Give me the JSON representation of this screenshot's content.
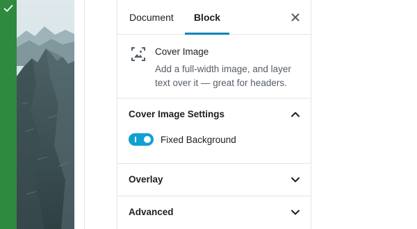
{
  "tabs": {
    "document_label": "Document",
    "block_label": "Block",
    "active": "Block"
  },
  "icons": {
    "close": "close-icon",
    "block": "cover-image-icon",
    "check": "checkmark-icon",
    "chevron_up": "chevron-up-icon",
    "chevron_down": "chevron-down-icon"
  },
  "block_card": {
    "title": "Cover Image",
    "description": "Add a full-width image, and layer text over it — great for headers."
  },
  "panels": {
    "settings": {
      "title": "Cover Image Settings",
      "expanded": true,
      "fixed_background": {
        "label": "Fixed Background",
        "checked": true
      }
    },
    "overlay": {
      "title": "Overlay",
      "expanded": false
    },
    "advanced": {
      "title": "Advanced",
      "expanded": false
    }
  },
  "colors": {
    "accent": "#0085ba",
    "toggle_on": "#11a0d2",
    "success_bar": "#2e8b3e"
  }
}
